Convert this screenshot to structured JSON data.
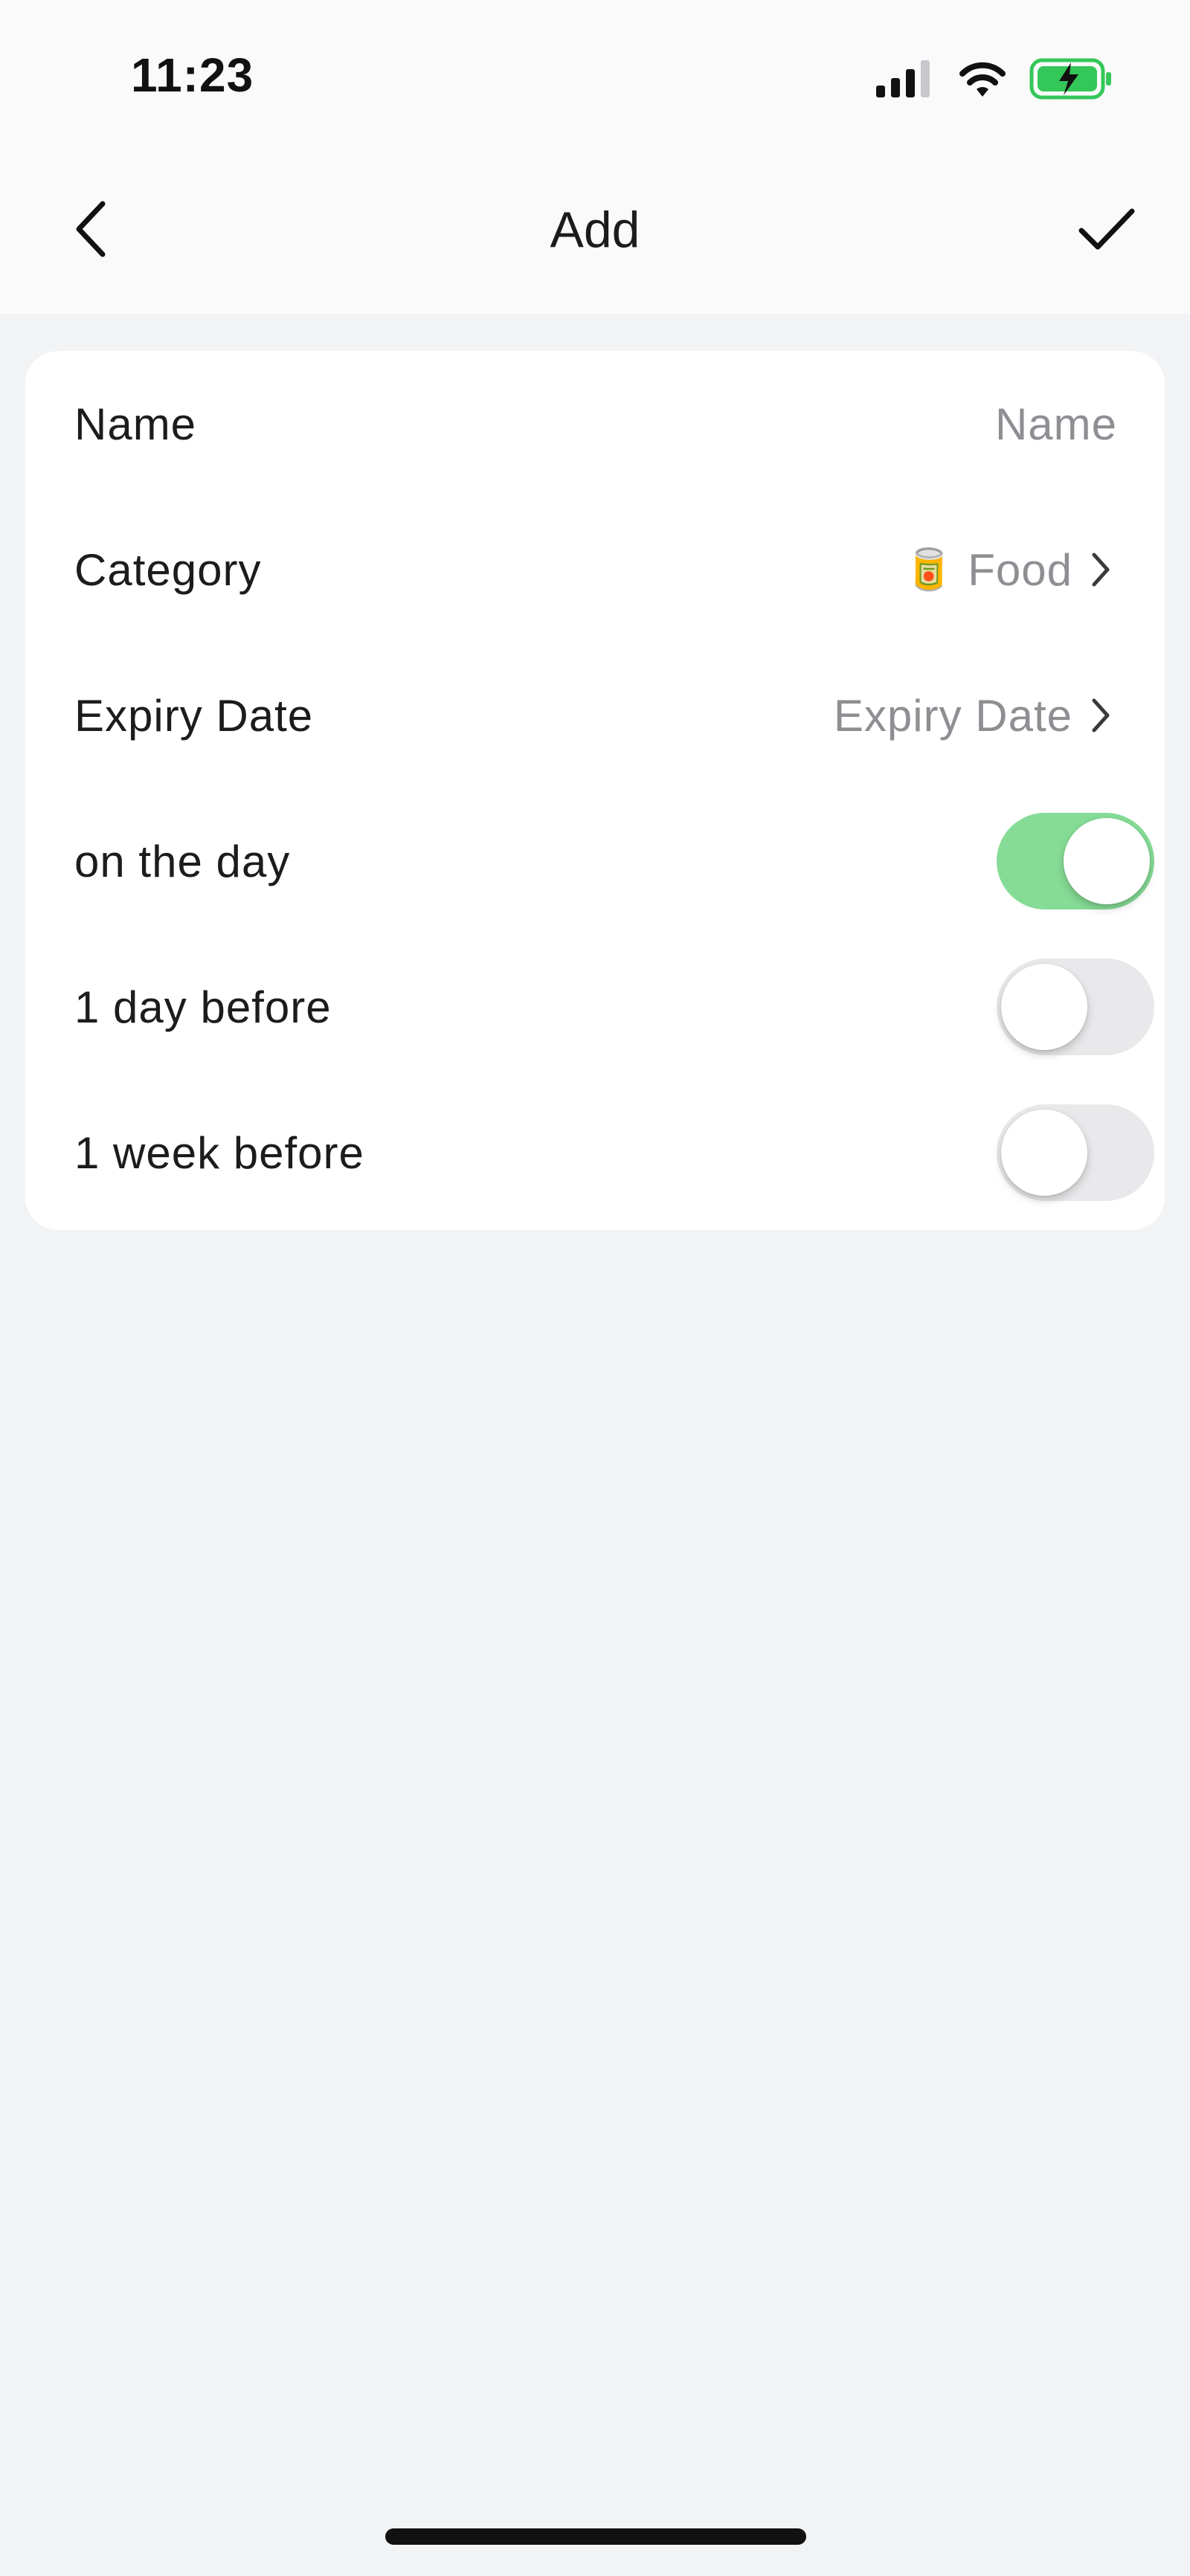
{
  "status_bar": {
    "time": "11:23",
    "icons": [
      "cellular-signal-icon",
      "wifi-icon",
      "battery-charging-icon"
    ]
  },
  "nav": {
    "title": "Add",
    "back_icon": "chevron-left-icon",
    "done_icon": "checkmark-icon"
  },
  "form": {
    "name": {
      "label": "Name",
      "placeholder": "Name"
    },
    "category": {
      "label": "Category",
      "icon": "🥫",
      "value": "Food"
    },
    "expiry": {
      "label": "Expiry Date",
      "value": "Expiry Date"
    },
    "reminders": [
      {
        "label": "on the day",
        "on": true
      },
      {
        "label": "1 day before",
        "on": false
      },
      {
        "label": "1 week before",
        "on": false
      }
    ]
  },
  "colors": {
    "toggle_on": "#86dc96",
    "toggle_off": "#e9e9eb",
    "background": "#f2f3f5"
  }
}
